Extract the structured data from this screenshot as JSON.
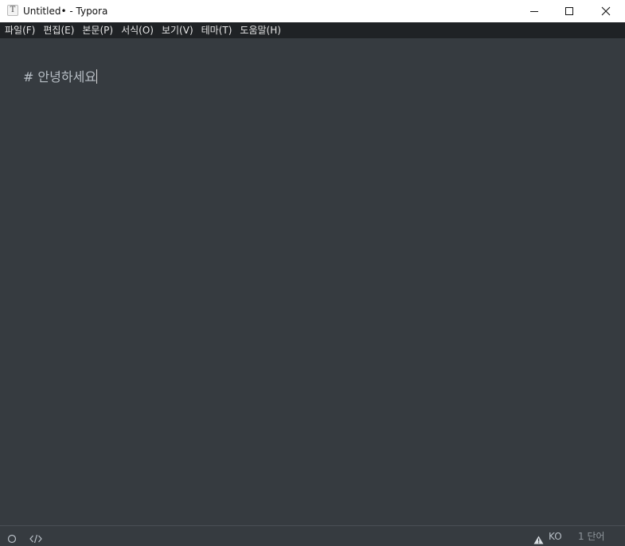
{
  "titlebar": {
    "app_icon_letter": "T",
    "title": "Untitled• - Typora",
    "icons": {
      "minimize": "minimize-icon",
      "maximize": "maximize-icon",
      "close": "close-icon"
    }
  },
  "menu": {
    "items": [
      {
        "label": "파일(F)"
      },
      {
        "label": "편집(E)"
      },
      {
        "label": "본문(P)"
      },
      {
        "label": "서식(O)"
      },
      {
        "label": "보기(V)"
      },
      {
        "label": "테마(T)"
      },
      {
        "label": "도움말(H)"
      }
    ]
  },
  "editor": {
    "hash": "#",
    "text": "안녕하세요"
  },
  "statusbar": {
    "outline_icon": "circle-outline-icon",
    "source_icon": "code-icon",
    "warning_icon": "warning-icon",
    "language": "KO",
    "word_count": "1 단어"
  },
  "colors": {
    "background": "#363b40",
    "menubar": "#1f2225",
    "titlebar": "#ffffff",
    "text": "#b8bfc6"
  }
}
